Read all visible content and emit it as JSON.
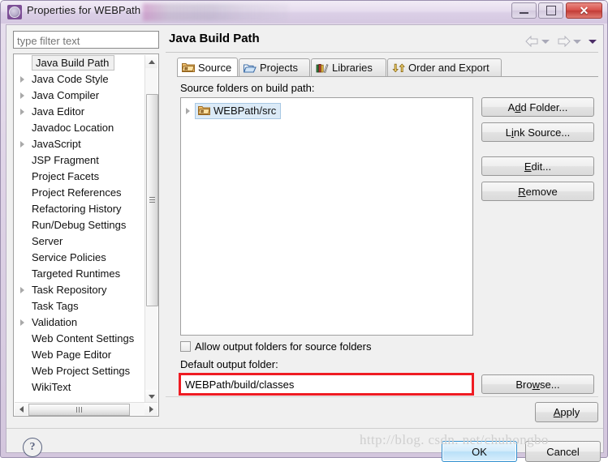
{
  "window": {
    "title": "Properties for WEBPath",
    "icon": "eclipse-properties-icon",
    "minimize_label": "Minimize",
    "maximize_label": "Maximize",
    "close_label": "✕"
  },
  "filter": {
    "placeholder": "type filter text",
    "value": ""
  },
  "tree": {
    "items": [
      {
        "label": "Java Build Path",
        "expandable": false,
        "selected": true
      },
      {
        "label": "Java Code Style",
        "expandable": true,
        "selected": false
      },
      {
        "label": "Java Compiler",
        "expandable": true,
        "selected": false
      },
      {
        "label": "Java Editor",
        "expandable": true,
        "selected": false
      },
      {
        "label": "Javadoc Location",
        "expandable": false,
        "selected": false
      },
      {
        "label": "JavaScript",
        "expandable": true,
        "selected": false
      },
      {
        "label": "JSP Fragment",
        "expandable": false,
        "selected": false
      },
      {
        "label": "Project Facets",
        "expandable": false,
        "selected": false
      },
      {
        "label": "Project References",
        "expandable": false,
        "selected": false
      },
      {
        "label": "Refactoring History",
        "expandable": false,
        "selected": false
      },
      {
        "label": "Run/Debug Settings",
        "expandable": false,
        "selected": false
      },
      {
        "label": "Server",
        "expandable": false,
        "selected": false
      },
      {
        "label": "Service Policies",
        "expandable": false,
        "selected": false
      },
      {
        "label": "Targeted Runtimes",
        "expandable": false,
        "selected": false
      },
      {
        "label": "Task Repository",
        "expandable": true,
        "selected": false
      },
      {
        "label": "Task Tags",
        "expandable": false,
        "selected": false
      },
      {
        "label": "Validation",
        "expandable": true,
        "selected": false
      },
      {
        "label": "Web Content Settings",
        "expandable": false,
        "selected": false
      },
      {
        "label": "Web Page Editor",
        "expandable": false,
        "selected": false
      },
      {
        "label": "Web Project Settings",
        "expandable": false,
        "selected": false
      },
      {
        "label": "WikiText",
        "expandable": false,
        "selected": false
      }
    ]
  },
  "page": {
    "title": "Java Build Path",
    "nav": {
      "back_icon": "back-arrow-icon",
      "back_menu_icon": "chevron-down-icon",
      "forward_icon": "forward-arrow-icon",
      "forward_menu_icon": "chevron-down-icon",
      "more_icon": "chevron-down-icon"
    }
  },
  "tabs": [
    {
      "label": "Source",
      "icon": "source-folder-icon",
      "active": true
    },
    {
      "label": "Projects",
      "icon": "projects-folder-icon",
      "active": false
    },
    {
      "label": "Libraries",
      "icon": "libraries-books-icon",
      "active": false
    },
    {
      "label": "Order and Export",
      "icon": "order-export-icon",
      "active": false
    }
  ],
  "source_tab": {
    "list_label": "Source folders on build path:",
    "entries": [
      {
        "label": "WEBPath/src",
        "icon": "source-folder-icon",
        "selected": true,
        "expandable": true
      }
    ],
    "buttons": [
      {
        "name": "add-folder",
        "label": "Add Folder...",
        "mnemonic": "d"
      },
      {
        "name": "link-source",
        "label": "Link Source...",
        "mnemonic": "i"
      },
      {
        "name": "edit",
        "label": "Edit...",
        "mnemonic": "E"
      },
      {
        "name": "remove",
        "label": "Remove",
        "mnemonic": "R"
      }
    ],
    "allow_output_folders": {
      "label": "Allow output folders for source folders",
      "checked": false
    },
    "default_output_folder": {
      "label": "Default output folder:",
      "value": "WEBPath/build/classes",
      "highlight_color": "#ef1c23"
    },
    "browse_label": "Browse..."
  },
  "footer": {
    "apply_label": "Apply",
    "help_icon": "question-mark-icon",
    "ok_label": "OK",
    "cancel_label": "Cancel"
  },
  "watermark": "http://blog. csdn. net/chuhongbo",
  "colors": {
    "accent": "#7d4f96",
    "highlight_red": "#ef1c23",
    "ok_border": "#2f8fd0",
    "selection_blue": "#dbeaf7"
  }
}
